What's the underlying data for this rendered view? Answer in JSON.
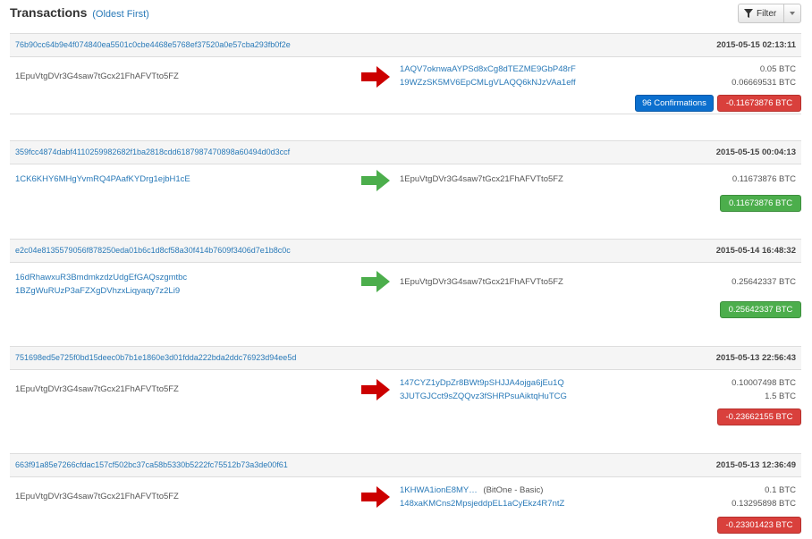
{
  "header": {
    "title": "Transactions",
    "subtitle": "(Oldest First)",
    "filter_label": "Filter"
  },
  "colors": {
    "outgoing": "#cc0000",
    "incoming": "#4cae4c",
    "link": "#2a7ab8",
    "confirm": "#0b6fce"
  },
  "transactions": [
    {
      "hash": "76b90cc64b9e4f074840ea5501c0cbe4468e5768ef37520a0e57cba293fb0f2e",
      "time": "2015-05-15 02:13:11",
      "direction": "out",
      "arrow_icon": "arrow-right-red-icon",
      "source": "1EpuVtgDVr3G4saw7tGcx21FhAFVTto5FZ",
      "outputs": [
        "1AQV7oknwaAYPSd8xCg8dTEZME9GbP48rF",
        "19WZzSK5MV6EpCMLgVLAQQ6kNJzVAa1eff"
      ],
      "amounts": [
        "0.05 BTC",
        "0.06669531 BTC"
      ],
      "confirmations": "96 Confirmations",
      "total": "-0.11673876 BTC"
    },
    {
      "hash": "359fcc4874dabf4110259982682f1ba2818cdd6187987470898a60494d0d3ccf",
      "time": "2015-05-15 00:04:13",
      "direction": "in",
      "arrow_icon": "arrow-right-green-icon",
      "source": "1CK6KHY6MHgYvmRQ4PAafKYDrg1ejbH1cE",
      "output": "1EpuVtgDVr3G4saw7tGcx21FhAFVTto5FZ",
      "amounts": [
        "0.11673876 BTC"
      ],
      "total": "0.11673876 BTC"
    },
    {
      "hash": "e2c04e8135579056f878250eda01b6c1d8cf58a30f414b7609f3406d7e1b8c0c",
      "time": "2015-05-14 16:48:32",
      "direction": "in",
      "arrow_icon": "arrow-right-green-icon",
      "sources": [
        "16dRhawxuR3BmdmkzdzUdgEfGAQszgmtbc",
        "1BZgWuRUzP3aFZXgDVhzxLiqyaqy7z2Li9"
      ],
      "output": "1EpuVtgDVr3G4saw7tGcx21FhAFVTto5FZ",
      "amounts": [
        "0.25642337 BTC"
      ],
      "total": "0.25642337 BTC"
    },
    {
      "hash": "751698ed5e725f0bd15deec0b7b1e1860e3d01fdda222bda2ddc76923d94ee5d",
      "time": "2015-05-13 22:56:43",
      "direction": "out",
      "arrow_icon": "arrow-right-red-icon",
      "source": "1EpuVtgDVr3G4saw7tGcx21FhAFVTto5FZ",
      "outputs": [
        "147CYZ1yDpZr8BWt9pSHJJA4ojga6jEu1Q",
        "3JUTGJCct9sZQQvz3fSHRPsuAiktqHuTCG"
      ],
      "amounts": [
        "0.10007498 BTC",
        "1.5 BTC"
      ],
      "total": "-0.23662155 BTC"
    },
    {
      "hash": "663f91a85e7266cfdac157cf502bc37ca58b5330b5222fc75512b73a3de00f61",
      "time": "2015-05-13 12:36:49",
      "direction": "out",
      "arrow_icon": "arrow-right-red-icon",
      "source": "1EpuVtgDVr3G4saw7tGcx21FhAFVTto5FZ",
      "outputs": [
        "1KHWA1ionE8MY…",
        "148xaKMCns2MpsjeddpEL1aCyEkz4R7ntZ"
      ],
      "output_label": "(BitOne - Basic)",
      "amounts": [
        "0.1 BTC",
        "0.13295898 BTC"
      ],
      "total": "-0.23301423 BTC"
    }
  ]
}
